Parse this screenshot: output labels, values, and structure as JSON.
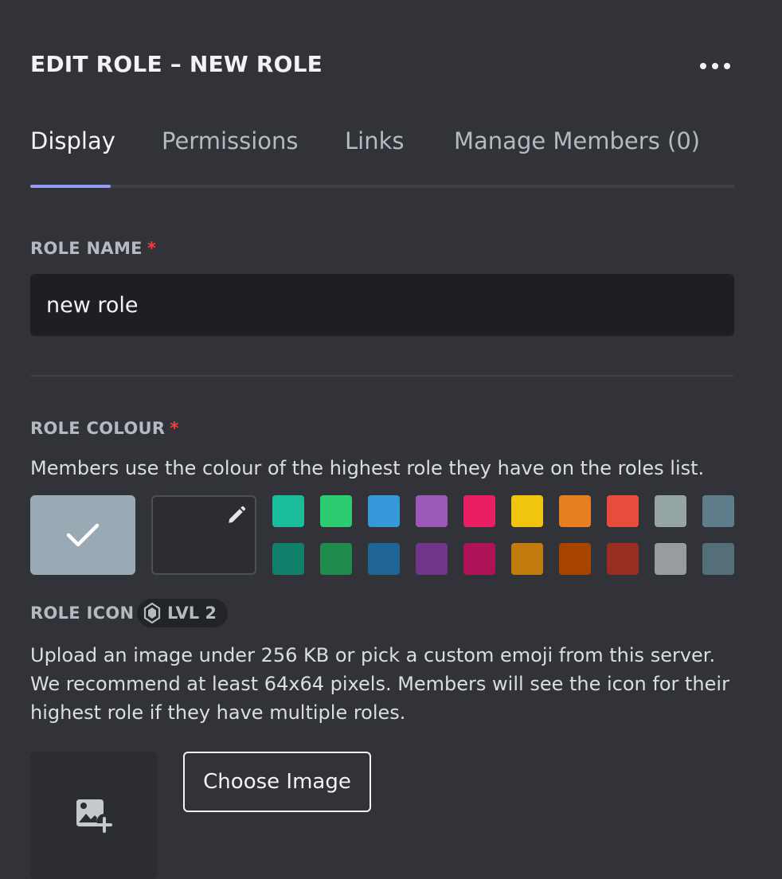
{
  "header": {
    "title": "EDIT ROLE – NEW ROLE",
    "more_icon": "more-horizontal-icon"
  },
  "tabs": [
    {
      "label": "Display",
      "active": true
    },
    {
      "label": "Permissions",
      "active": false
    },
    {
      "label": "Links",
      "active": false
    },
    {
      "label": "Manage Members (0)",
      "active": false
    }
  ],
  "role_name": {
    "label": "ROLE NAME",
    "required_mark": "*",
    "value": "new role"
  },
  "role_colour": {
    "label": "ROLE COLOUR",
    "required_mark": "*",
    "description": "Members use the colour of the highest role they have on the roles list.",
    "default_color": "#99aab5",
    "default_selected": true,
    "check_icon": "check-icon",
    "custom_icon": "pencil-icon",
    "palette_top": [
      "#1abc9c",
      "#2ecc71",
      "#3498db",
      "#9b59b6",
      "#e91e63",
      "#f1c40f",
      "#e67e22",
      "#e74c3c",
      "#95a5a6",
      "#607d8b"
    ],
    "palette_bottom": [
      "#11806a",
      "#1f8b4c",
      "#206694",
      "#71368a",
      "#ad1457",
      "#c27c0e",
      "#a84300",
      "#992d22",
      "#979c9f",
      "#546e7a"
    ]
  },
  "role_icon": {
    "label": "ROLE ICON",
    "badge_label": "LVL 2",
    "badge_icon": "boost-gem-icon",
    "description": "Upload an image under 256 KB or pick a custom emoji from this server. We recommend at least 64x64 pixels. Members will see the icon for their highest role if they have multiple roles.",
    "placeholder_icon": "image-add-icon",
    "choose_button": "Choose Image"
  }
}
